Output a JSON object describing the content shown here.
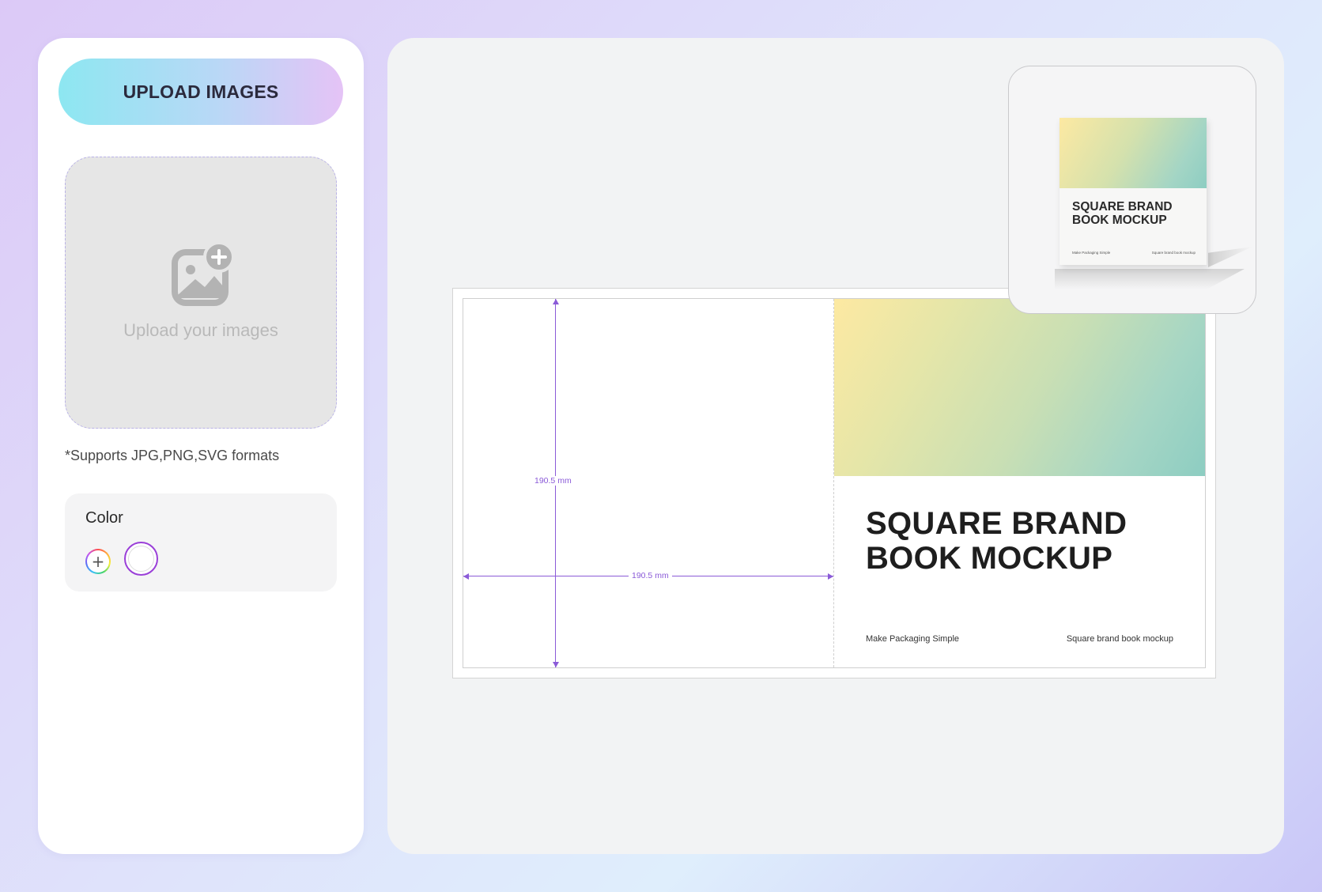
{
  "sidebar": {
    "upload_button_label": "UPLOAD IMAGES",
    "dropzone_text": "Upload your images",
    "formats_note": "*Supports JPG,PNG,SVG formats",
    "color": {
      "title": "Color",
      "add_symbol": "+",
      "selected_color": "#ffffff",
      "accent": "#9a3fd8"
    }
  },
  "canvas": {
    "dimensions": {
      "height_label": "190.5 mm",
      "width_label": "190.5 mm",
      "color": "#8b5bd8"
    },
    "front_cover": {
      "title_line1": "SQUARE BRAND",
      "title_line2": "BOOK MOCKUP",
      "footer_left": "Make Packaging Simple",
      "footer_right": "Square brand book mockup"
    },
    "preview": {
      "title_line1": "SQUARE BRAND",
      "title_line2": "BOOK MOCKUP",
      "footer_left": "Make Packaging Simple",
      "footer_right": "Square brand book mockup"
    }
  }
}
